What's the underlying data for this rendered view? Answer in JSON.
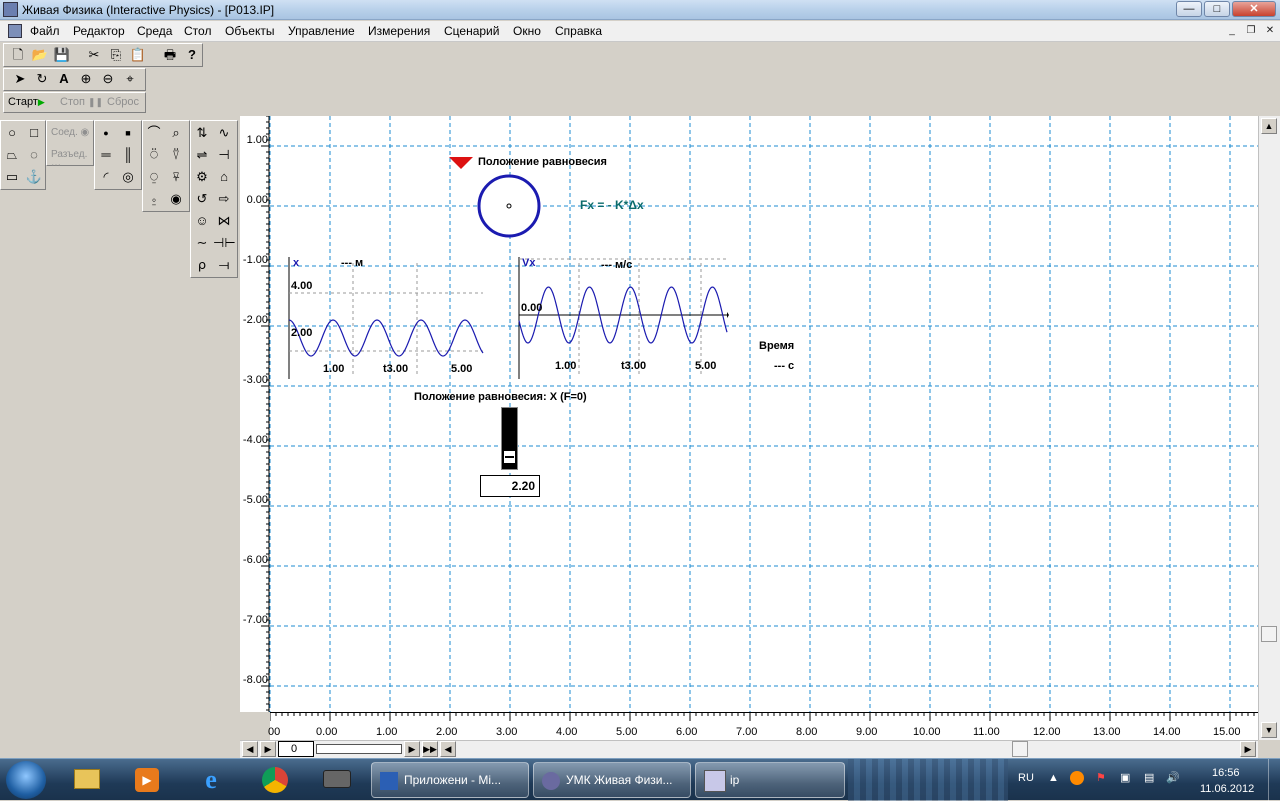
{
  "window": {
    "title": "Живая Физика (Interactive Physics) - [P013.IP]",
    "caption_buttons": {
      "minimize": "—",
      "maximize": "□",
      "close": "✕"
    }
  },
  "menu": {
    "items": [
      "Файл",
      "Редактор",
      "Среда",
      "Стол",
      "Объекты",
      "Управление",
      "Измерения",
      "Сценарий",
      "Окно",
      "Справка"
    ],
    "mdi_buttons": {
      "minimize": "_",
      "restore": "❐",
      "close": "✕"
    }
  },
  "toolbar": {
    "file_icons": [
      "new-document-icon",
      "open-folder-icon",
      "save-icon",
      "cut-icon",
      "copy-icon",
      "paste-icon",
      "print-icon",
      "help-icon"
    ],
    "tool_icons": [
      "arrow-icon",
      "rotate-icon",
      "text-icon",
      "zoom-in-icon",
      "zoom-out-icon",
      "zoom-fit-icon"
    ],
    "run": {
      "start": "Старт",
      "stop": "Стоп",
      "reset": "Сброс"
    }
  },
  "palette": {
    "join": "Соед.",
    "split": "Разъед."
  },
  "workspace": {
    "y_ticks": [
      "1.00",
      "0.00",
      "-1.00",
      "-2.00",
      "-3.00",
      "-4.00",
      "-5.00",
      "-6.00",
      "-7.00",
      "-8.00"
    ],
    "x_ticks": [
      "00",
      "0.00",
      "1.00",
      "2.00",
      "3.00",
      "4.00",
      "5.00",
      "6.00",
      "7.00",
      "8.00",
      "9.00",
      "10.00",
      "11.00",
      "12.00",
      "13.00",
      "14.00",
      "15.00"
    ],
    "anchor_label": "Положение равновесия",
    "formula": "Fx = - K*Δx",
    "graph_x": {
      "var": "x",
      "unit": "--- м",
      "y_labels": [
        "4.00",
        "2.00"
      ],
      "x_labels": [
        "1.00",
        "t3.00",
        "5.00"
      ]
    },
    "graph_v": {
      "var": "Vx",
      "unit": "--- м/с",
      "y_labels": [
        "0.00"
      ],
      "x_labels": [
        "1.00",
        "t3.00",
        "5.00"
      ]
    },
    "time_label": "Время",
    "time_unit": "--- с",
    "slider": {
      "label": "Положение равновесия: X  (F=0)",
      "value": "2.20"
    }
  },
  "hscroll": {
    "frame": "0"
  },
  "taskbar": {
    "pinned": [
      "explorer-icon",
      "media-player-icon",
      "ie-icon",
      "chrome-icon",
      "device-icon"
    ],
    "tasks": [
      "Приложени - Mi...",
      "УМК Живая Физи...",
      "ip"
    ],
    "lang": "RU",
    "time": "16:56",
    "date": "11.06.2012"
  }
}
